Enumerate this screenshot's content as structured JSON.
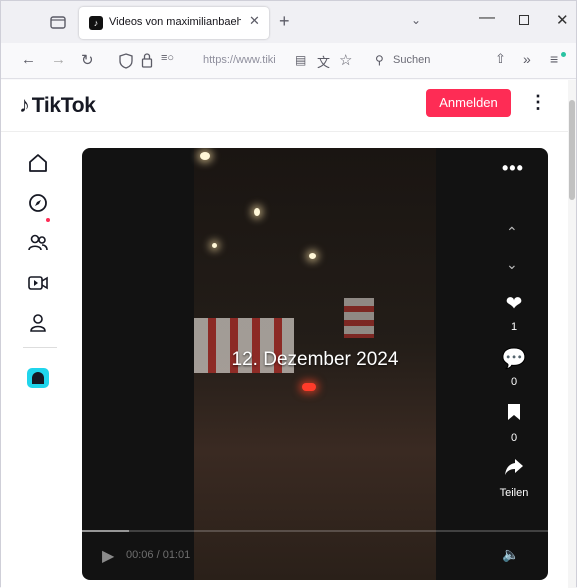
{
  "browser": {
    "tab_title": "Videos von maximilianbaehring",
    "tab_close": "✕",
    "new_tab": "+",
    "url_text": "https://www.tiki",
    "search_placeholder": "Suchen"
  },
  "tiktok": {
    "logo_text": "TikTok",
    "login_label": "Anmelden"
  },
  "video": {
    "date_overlay": "12. Dezember 2024",
    "likes": "1",
    "comments": "0",
    "bookmarks": "0",
    "share_label": "Teilen",
    "time": "00:06 / 01:01",
    "progress": 0.1
  },
  "colors": {
    "brand": "#fe2c55",
    "accent": "#20d5ec"
  }
}
